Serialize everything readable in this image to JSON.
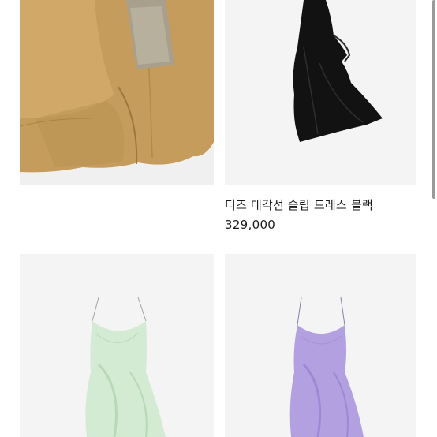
{
  "products": [
    {
      "image": "mustard satin draped skirt with lace panel",
      "name": "",
      "price": ""
    },
    {
      "image": "black asymmetric slip dress",
      "name": "티즈 대각선 슬립 드레스 블랙",
      "price": "329,000"
    },
    {
      "image": "mint green ruffled slip dress",
      "name": "",
      "price": ""
    },
    {
      "image": "lavender ruffled slip dress",
      "name": "",
      "price": ""
    }
  ],
  "colors": {
    "mustard": "#c9a163",
    "black": "#121212",
    "mint": "#cfe8cf",
    "lavender": "#b6a3e2",
    "photo_bg": "#f4f4f4"
  }
}
